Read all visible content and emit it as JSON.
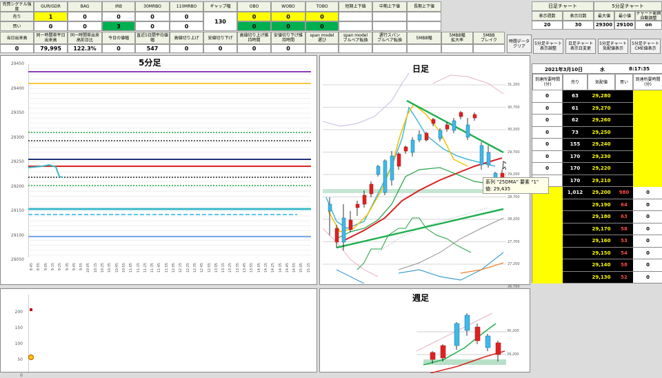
{
  "top_headers": [
    "売買シグナル強度",
    "GUR/GDR",
    "BAG",
    "IRB",
    "30MRBO",
    "110MRBO",
    "ギャップ幅",
    "OBO",
    "WOBO",
    "TOBO",
    "短期上下値",
    "中期上下値",
    "長期上下値"
  ],
  "row1_label": "売り",
  "row2_label": "買い",
  "row1_vals": [
    "1",
    "0",
    "0",
    "0",
    "0",
    "",
    "0",
    "0",
    "0",
    "",
    "",
    ""
  ],
  "row2_vals": [
    "0",
    "0",
    "3",
    "0",
    "0",
    "",
    "0",
    "0",
    "0",
    "",
    "",
    ""
  ],
  "gap_value": "130",
  "mid_headers": [
    "当日出来高",
    "同一時間帯平日\n出来高",
    "同一時間帯出来\n高前日比",
    "今日の値幅",
    "直近5日間平均値\n幅",
    "高値切り上げ",
    "安値切り下げ",
    "高値切り上げ維\n持時間",
    "安値切り下げ維\n持時間",
    "span model\n遅び",
    "span model\nブルベア転換",
    "遅行スパン\nブルベア転換",
    "5MBB幅",
    "5MBB幅\n拡大率",
    "5MBB\nブレイク"
  ],
  "mid_vals": [
    "0",
    "79,995",
    "122.3%",
    "0",
    "547",
    "0",
    "0",
    "0",
    "0",
    "",
    "",
    "",
    "",
    "",
    ""
  ],
  "right_headers": [
    "日足チャート",
    "5分足チャート"
  ],
  "right_sub": [
    "表示週数",
    "表示日数",
    "最大値",
    "最小値",
    "チャート範囲\n自動調整"
  ],
  "right_vals": [
    "20",
    "30",
    "29300",
    "29100",
    "on"
  ],
  "btn_labels": [
    "時間データ\nクリア",
    "5分足チャート\n表示調整",
    "日足チャート\n表示日変更",
    "5分足チャート\n気配値表示",
    "5分足チャート\nCME値表示"
  ],
  "panel_5min": {
    "title": "5分足",
    "y_labels": [
      "29450",
      "29400",
      "29350",
      "29300",
      "29250",
      "29200",
      "29150",
      "29100",
      "29050"
    ],
    "x_labels": [
      "8:45",
      "8:55",
      "9:05",
      "9:15",
      "9:25",
      "9:35",
      "9:45",
      "9:55",
      "10:05",
      "10:15",
      "10:25",
      "10:35",
      "10:45",
      "10:55",
      "11:05",
      "11:15",
      "11:25",
      "11:35",
      "11:45",
      "11:55",
      "12:05",
      "12:15",
      "12:25",
      "12:35",
      "12:45",
      "12:55",
      "13:05",
      "13:15",
      "13:25",
      "13:35",
      "13:45",
      "13:55",
      "14:05",
      "14:15",
      "14:25",
      "14:35",
      "14:45",
      "14:55",
      "15:05",
      "15:15"
    ]
  },
  "panel_vol": {
    "y_labels": [
      "200",
      "150",
      "100",
      "50",
      "0"
    ]
  },
  "panel_daily": {
    "title": "日足",
    "y_labels": [
      "31,200",
      "30,700",
      "30,200",
      "29,700",
      "29,200",
      "28,700",
      "28,200",
      "27,700",
      "27,200",
      "26,700"
    ],
    "tooltip_line1": "系列 \"25DMA\" 要素 \"1\"",
    "tooltip_line2": "値: 29,435"
  },
  "panel_weekly": {
    "title": "週足",
    "y_labels": [
      "30,200",
      "29,200"
    ]
  },
  "orderbook": {
    "date": "2021年3月10日",
    "weekday": "水",
    "time": "8:17:35",
    "headers": [
      "到達所要時間\n(分)",
      "売り",
      "気配値",
      "買い",
      "到達所要時間\n(分)"
    ],
    "rows": [
      [
        "0",
        "63",
        "29,280",
        "",
        ""
      ],
      [
        "0",
        "61",
        "29,270",
        "",
        ""
      ],
      [
        "0",
        "62",
        "29,260",
        "",
        ""
      ],
      [
        "0",
        "73",
        "29,250",
        "",
        ""
      ],
      [
        "0",
        "155",
        "29,240",
        "",
        ""
      ],
      [
        "0",
        "170",
        "29,230",
        "",
        ""
      ],
      [
        "0",
        "170",
        "29,220",
        "",
        ""
      ],
      [
        "0",
        "170",
        "29,210",
        "",
        ""
      ],
      [
        "",
        "1,012",
        "29,200",
        "980",
        "0"
      ],
      [
        "",
        "",
        "29,190",
        "64",
        "0"
      ],
      [
        "",
        "",
        "29,180",
        "63",
        "0"
      ],
      [
        "",
        "",
        "29,170",
        "58",
        "0"
      ],
      [
        "",
        "",
        "29,160",
        "53",
        "0"
      ],
      [
        "",
        "",
        "29,150",
        "54",
        "0"
      ],
      [
        "",
        "",
        "29,140",
        "58",
        "0"
      ],
      [
        "",
        "",
        "29,130",
        "52",
        "0"
      ]
    ]
  }
}
